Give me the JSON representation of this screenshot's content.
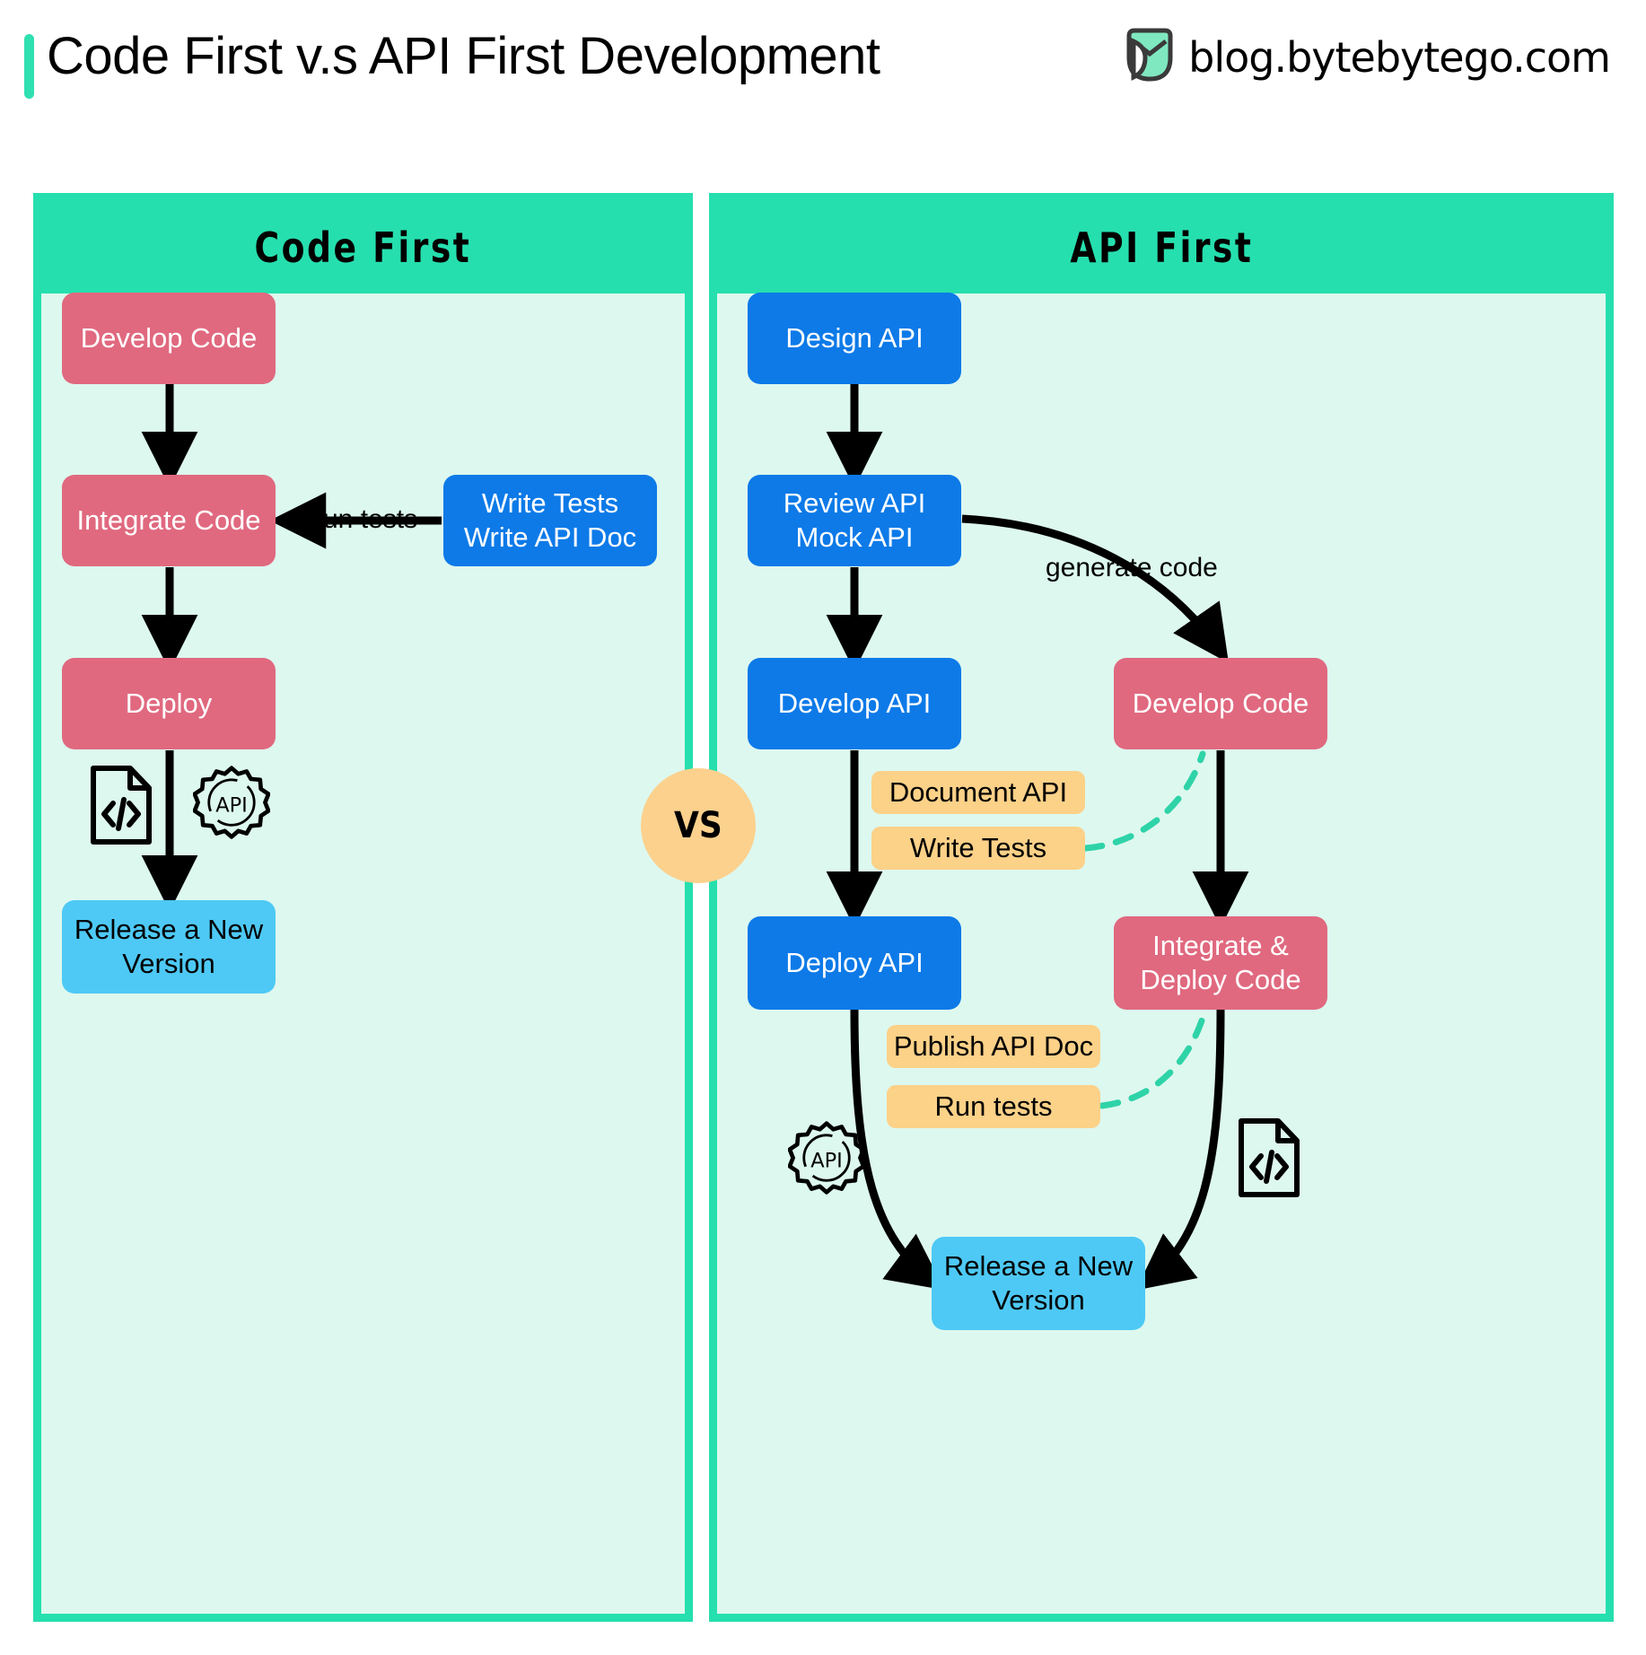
{
  "header": {
    "title": "Code First v.s API First Development",
    "brand": "blog.bytebytego.com",
    "brand_logo_icon": "bytebytego-logo-icon",
    "accent_color": "#2fe0b0"
  },
  "vs_badge": {
    "label": "VS",
    "color": "#fcd18d"
  },
  "colors": {
    "panel_border": "#26dfae",
    "panel_fill": "#ddf8ef",
    "node_red": "#e0697f",
    "node_blue": "#0d7ae8",
    "node_light_blue": "#4ec9f5",
    "node_amber": "#fcd188",
    "dashed_edge": "#2fd3a8",
    "edge": "#000000"
  },
  "panels": [
    {
      "id": "code-first",
      "title": "Code First",
      "nodes": [
        {
          "id": "cf-develop-code",
          "label": "Develop Code",
          "type": "red"
        },
        {
          "id": "cf-integrate-code",
          "label": "Integrate Code",
          "type": "red"
        },
        {
          "id": "cf-write-tests",
          "label": "Write Tests\nWrite API Doc",
          "type": "blue"
        },
        {
          "id": "cf-deploy",
          "label": "Deploy",
          "type": "red"
        },
        {
          "id": "cf-release",
          "label": "Release a New\nVersion",
          "type": "lblue"
        }
      ],
      "edge_labels": [
        {
          "id": "cf-run-tests",
          "label": "run tests"
        }
      ],
      "icons": [
        {
          "id": "cf-code-doc-icon",
          "name": "code-document-icon"
        },
        {
          "id": "cf-api-gear-icon",
          "name": "api-gear-icon",
          "label": "API"
        }
      ]
    },
    {
      "id": "api-first",
      "title": "API First",
      "nodes": [
        {
          "id": "af-design-api",
          "label": "Design API",
          "type": "blue"
        },
        {
          "id": "af-review-api",
          "label": "Review API\nMock API",
          "type": "blue"
        },
        {
          "id": "af-develop-api",
          "label": "Develop API",
          "type": "blue"
        },
        {
          "id": "af-develop-code",
          "label": "Develop Code",
          "type": "red"
        },
        {
          "id": "af-document-api",
          "label": "Document API",
          "type": "amber"
        },
        {
          "id": "af-write-tests",
          "label": "Write Tests",
          "type": "amber"
        },
        {
          "id": "af-deploy-api",
          "label": "Deploy API",
          "type": "blue"
        },
        {
          "id": "af-integrate-deploy",
          "label": "Integrate &\nDeploy Code",
          "type": "red"
        },
        {
          "id": "af-publish-api-doc",
          "label": "Publish API Doc",
          "type": "amber"
        },
        {
          "id": "af-run-tests",
          "label": "Run tests",
          "type": "amber"
        },
        {
          "id": "af-release",
          "label": "Release a New\nVersion",
          "type": "lblue"
        }
      ],
      "edge_labels": [
        {
          "id": "af-generate-code",
          "label": "generate code"
        }
      ],
      "icons": [
        {
          "id": "af-api-gear-icon",
          "name": "api-gear-icon",
          "label": "API"
        },
        {
          "id": "af-code-doc-icon",
          "name": "code-document-icon"
        }
      ]
    }
  ]
}
